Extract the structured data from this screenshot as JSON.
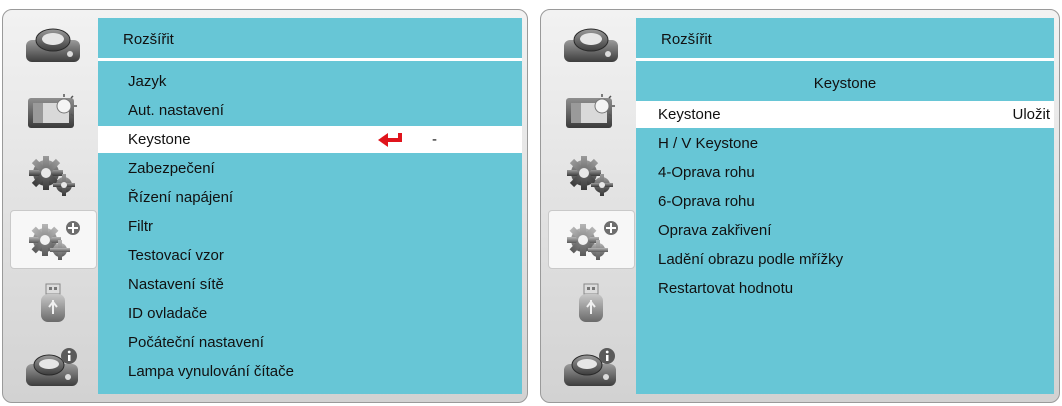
{
  "left_menu": {
    "title": "Rozšířit",
    "items": [
      {
        "label": "Jazyk"
      },
      {
        "label": "Aut. nastavení"
      },
      {
        "label": "Keystone",
        "value": "-"
      },
      {
        "label": "Zabezpečení"
      },
      {
        "label": "Řízení napájení"
      },
      {
        "label": "Filtr"
      },
      {
        "label": "Testovací vzor"
      },
      {
        "label": "Nastavení sítě"
      },
      {
        "label": "ID ovladače"
      },
      {
        "label": "Počáteční nastavení"
      },
      {
        "label": "Lampa vynulování čítače"
      }
    ],
    "selected_index": 2
  },
  "right_menu": {
    "title": "Rozšířit",
    "subheader": "Keystone",
    "items": [
      {
        "label": "Keystone",
        "value": "Uložit"
      },
      {
        "label": "H / V Keystone"
      },
      {
        "label": "4-Oprava rohu"
      },
      {
        "label": "6-Oprava rohu"
      },
      {
        "label": "Oprava zakřivení"
      },
      {
        "label": "Ladění obrazu podle mřížky"
      },
      {
        "label": "Restartovat hodnotu"
      }
    ],
    "selected_index": 0
  },
  "sidebar_icons": [
    "input-source-icon",
    "picture-icon",
    "settings-gears-icon",
    "advanced-settings-icon",
    "usb-icon",
    "info-icon"
  ],
  "active_sidebar_index": 3,
  "colors": {
    "content_bg": "#67c6d6",
    "selected_bg": "#ffffff",
    "enter_arrow": "#e0141c"
  }
}
